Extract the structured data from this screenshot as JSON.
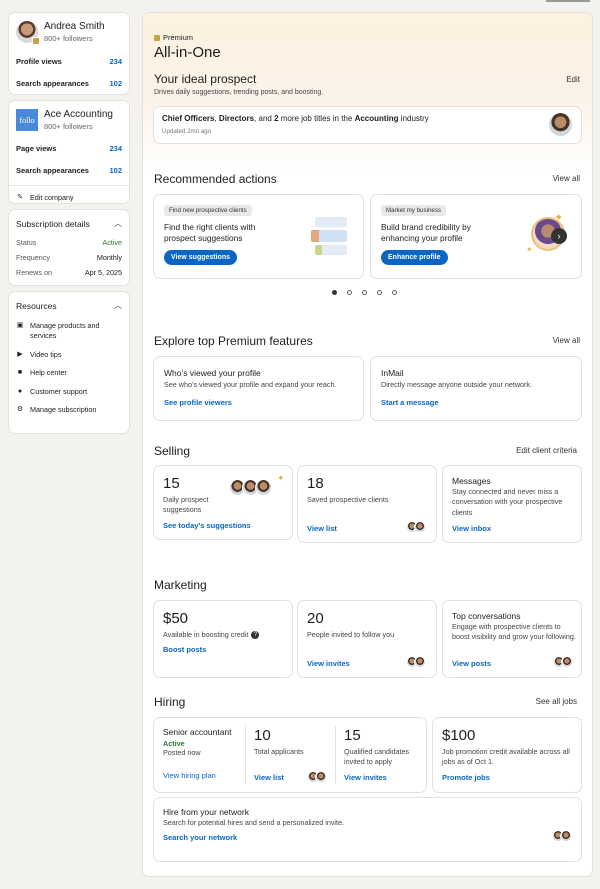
{
  "profile": {
    "name": "Andrea Smith",
    "followers": "800+ followers",
    "stats": [
      {
        "label": "Profile views",
        "value": "234"
      },
      {
        "label": "Search appearances",
        "value": "102"
      }
    ]
  },
  "company": {
    "logo_text": "follo",
    "name": "Ace Accounting",
    "followers": "800+ followers",
    "stats": [
      {
        "label": "Page views",
        "value": "234"
      },
      {
        "label": "Search appearances",
        "value": "102"
      }
    ],
    "edit_label": "Edit company"
  },
  "subscription": {
    "title": "Subscription details",
    "rows": [
      {
        "label": "Status",
        "value": "Active"
      },
      {
        "label": "Frequency",
        "value": "Monthly"
      },
      {
        "label": "Renews on",
        "value": "Apr 5, 2025"
      }
    ]
  },
  "resources": {
    "title": "Resources",
    "items": [
      {
        "label": "Manage products and services",
        "icon": "store-icon"
      },
      {
        "label": "Video tips",
        "icon": "play-icon"
      },
      {
        "label": "Help center",
        "icon": "book-icon"
      },
      {
        "label": "Customer support",
        "icon": "help-icon"
      },
      {
        "label": "Manage subscription",
        "icon": "gear-icon"
      }
    ]
  },
  "hero": {
    "premium_label": "Premium",
    "title": "All-in-One",
    "prospect_title": "Your ideal prospect",
    "prospect_sub": "Drives daily suggestions, trending posts, and boosting.",
    "edit": "Edit",
    "criteria": {
      "p1": "Chief Officers",
      "s1": ", ",
      "p2": "Directors",
      "s2": ", and ",
      "p3": "2",
      "s3": " more job titles in the ",
      "p4": "Accounting",
      "s4": " industry"
    },
    "updated": "Updated 2mo ago"
  },
  "recommended": {
    "title": "Recommended actions",
    "view_all": "View all",
    "cards": [
      {
        "tag": "Find new prospective clients",
        "title": "Find the right clients with prospect suggestions",
        "button": "View suggestions"
      },
      {
        "tag": "Market my business",
        "title": "Build brand credibility by enhancing your profile",
        "button": "Enhance profile"
      }
    ]
  },
  "features": {
    "title": "Explore top Premium features",
    "view_all": "View all",
    "cards": [
      {
        "title": "Who’s viewed your profile",
        "desc": "See who’s viewed your profile and expand your reach.",
        "link": "See profile viewers"
      },
      {
        "title": "InMail",
        "desc": "Directly message anyone outside your network.",
        "link": "Start a message"
      }
    ]
  },
  "selling": {
    "title": "Selling",
    "action": "Edit client criteria",
    "c1": {
      "num": "15",
      "desc": "Daily prospect suggestions",
      "link": "See today’s suggestions"
    },
    "c2": {
      "num": "18",
      "desc": "Saved prospective clients",
      "link": "View list"
    },
    "c3": {
      "title": "Messages",
      "desc": "Stay connected and never miss a conversation with your prospective clients",
      "link": "View inbox"
    }
  },
  "marketing": {
    "title": "Marketing",
    "c1": {
      "num": "$50",
      "desc": "Available in boosting credit",
      "link": "Boost posts"
    },
    "c2": {
      "num": "20",
      "desc": "People invited to follow you",
      "link": "View invites"
    },
    "c3": {
      "title": "Top conversations",
      "desc": "Engage with prospective clients to boost visibility and grow your following.",
      "link": "View posts"
    }
  },
  "hiring": {
    "title": "Hiring",
    "action": "See all jobs",
    "job": {
      "title": "Senior accountant",
      "status": "Active",
      "posted": "Posted now",
      "link": "View hiring plan"
    },
    "applicants": {
      "num": "10",
      "desc": "Total applicants",
      "link": "View list"
    },
    "qualified": {
      "num": "15",
      "desc": "Qualified candidates invited to apply",
      "link": "View invites"
    },
    "promo": {
      "num": "$100",
      "desc": "Job promotion credit available across all jobs as of Oct 1.",
      "link": "Promote jobs"
    },
    "network": {
      "title": "Hire from your network",
      "desc": "Search for potential hires and send a personalized invite.",
      "link": "Search your network"
    }
  },
  "colors": {
    "accent": "#0a66c2",
    "premium_gold": "#c7a24a",
    "active_green": "#2e7d32"
  }
}
